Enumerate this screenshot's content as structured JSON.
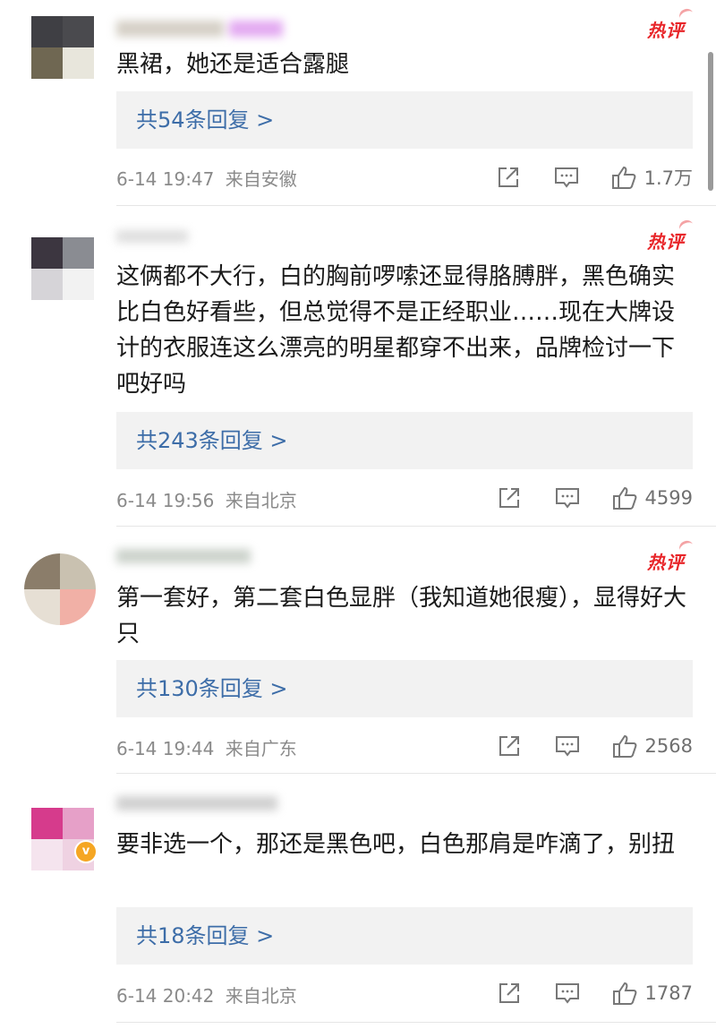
{
  "colors": {
    "link": "#3d6da8",
    "hot": "#e8262a",
    "reply_bg": "#f2f2f2",
    "meta": "#8a8a8a",
    "text": "#1a1a1a"
  },
  "comments": [
    {
      "hot_label": "热评",
      "text": "黑裙，她还是适合露腿",
      "reply_link": "共54条回复 >",
      "timestamp": "6-14 19:47",
      "location": "来自安徽",
      "likes": "1.7万",
      "icons": [
        "share-icon",
        "comment-icon",
        "like-icon"
      ]
    },
    {
      "hot_label": "热评",
      "text": "这俩都不大行，白的胸前啰嗦还显得胳膊胖，黑色确实比白色好看些，但总觉得不是正经职业……现在大牌设计的衣服连这么漂亮的明星都穿不出来，品牌检讨一下吧好吗",
      "reply_link": "共243条回复 >",
      "timestamp": "6-14 19:56",
      "location": "来自北京",
      "likes": "4599",
      "icons": [
        "share-icon",
        "comment-icon",
        "like-icon"
      ]
    },
    {
      "hot_label": "热评",
      "text": "第一套好，第二套白色显胖（我知道她很瘦），显得好大只",
      "reply_link": "共130条回复 >",
      "timestamp": "6-14 19:44",
      "location": "来自广东",
      "likes": "2568",
      "icons": [
        "share-icon",
        "comment-icon",
        "like-icon"
      ]
    },
    {
      "hot_label": "",
      "text": "要非选一个，那还是黑色吧，白色那肩是咋滴了，别扭",
      "reply_link": "共18条回复 >",
      "timestamp": "6-14 20:42",
      "location": "来自北京",
      "likes": "1787",
      "verified_badge": "v",
      "icons": [
        "share-icon",
        "comment-icon",
        "like-icon"
      ]
    }
  ]
}
